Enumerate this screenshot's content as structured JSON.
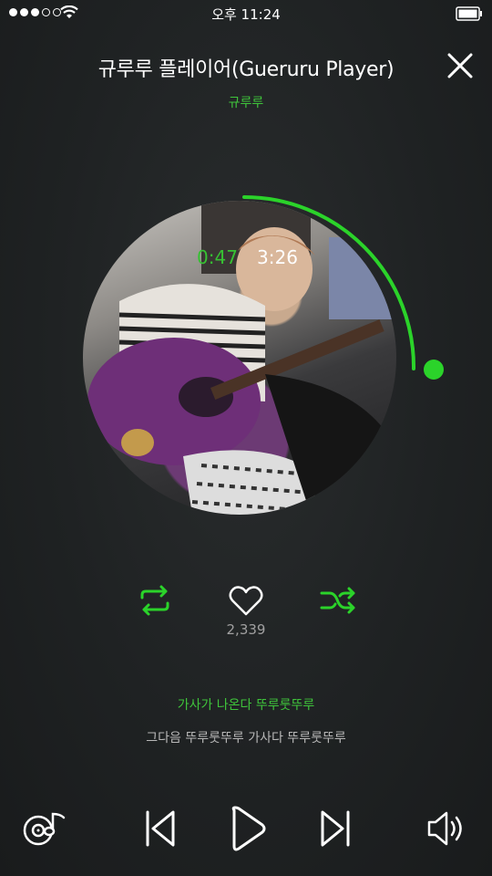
{
  "status_bar": {
    "time": "오후 11:24",
    "signal_bars": 5,
    "signal_filled": 3
  },
  "header": {
    "title": "규루루 플레이어(Gueruru Player)",
    "artist": "규루루",
    "close_icon": "close-icon"
  },
  "player": {
    "elapsed": "0:47",
    "total": "3:26",
    "progress": 0.228,
    "accent": "#2bd32a"
  },
  "controls": {
    "like_count": "2,339"
  },
  "lyrics": {
    "current": "가사가 나온다 뚜루룻뚜루",
    "next": "그다음 뚜루룻뚜루 가사다 뚜루룻뚜루"
  },
  "icons": [
    "repeat-icon",
    "heart-icon",
    "shuffle-icon",
    "music-library-icon",
    "previous-icon",
    "play-icon",
    "next-icon",
    "volume-icon"
  ]
}
